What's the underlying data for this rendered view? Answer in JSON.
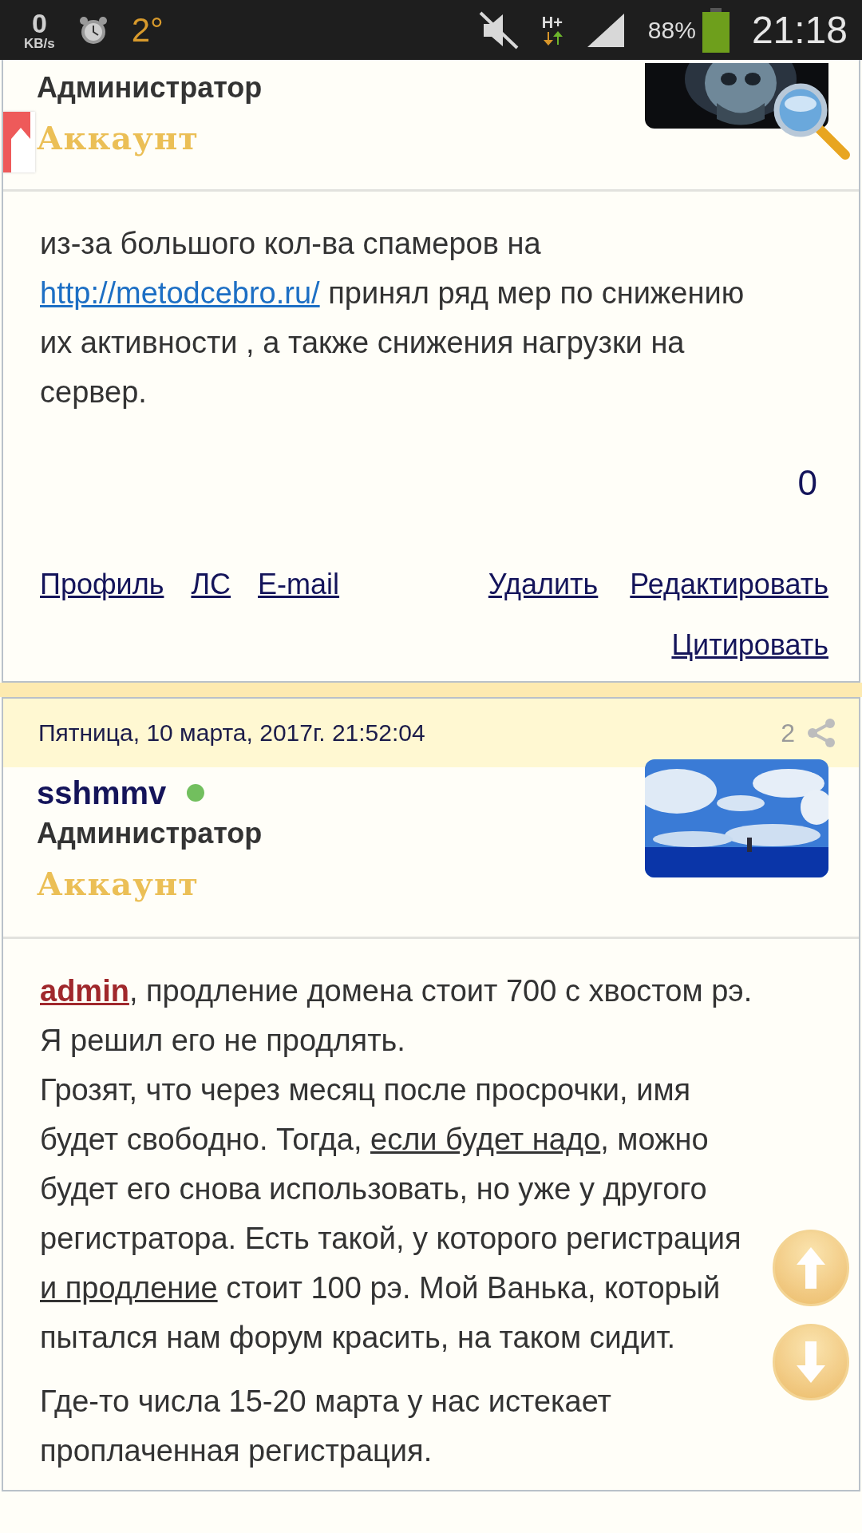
{
  "status_bar": {
    "speed_value": "0",
    "speed_unit": "KB/s",
    "temperature": "2°",
    "network_type": "H+",
    "battery_text": "88%",
    "time": "21:18"
  },
  "posts": [
    {
      "role": "Администратор",
      "rank": "Аккаунт",
      "body": [
        [
          [
            {
              "kind": "text",
              "text": "из-за большого кол-ва спамеров на "
            },
            {
              "kind": "link",
              "text": "http://metodcebro.ru/"
            },
            {
              "kind": "text",
              "text": " принял ряд мер по снижению их активности , а также снижения нагрузки на сервер."
            }
          ]
        ]
      ],
      "rating": "0",
      "actions": [
        {
          "kind": "user",
          "label": "Профиль"
        },
        {
          "kind": "user",
          "label": "ЛС"
        },
        {
          "kind": "user",
          "label": "E-mail"
        },
        {
          "kind": "post",
          "label": "Удалить"
        },
        {
          "kind": "post",
          "label": "Редактировать"
        },
        {
          "kind": "post",
          "label": "Цитировать"
        }
      ]
    },
    {
      "date": "Пятница, 10 марта, 2017г. 21:52:04",
      "number": "2",
      "username": "sshmmv",
      "online": true,
      "role": "Администратор",
      "rank": "Аккаунт",
      "body": [
        [
          [
            {
              "kind": "mention",
              "text": "admin"
            },
            {
              "kind": "text",
              "text": ", продление домена стоит 700 с хвостом рэ. Я решил его не продлять."
            }
          ],
          [
            {
              "kind": "text",
              "text": "Грозят, что через месяц после просрочки, имя будет свободно. Тогда, "
            },
            {
              "kind": "link",
              "text": "если будет надо"
            },
            {
              "kind": "text",
              "text": ", можно будет его снова использовать, но уже у другого регистратора. Есть такой, у которого регистрация "
            },
            {
              "kind": "link",
              "text": "и продление"
            },
            {
              "kind": "text",
              "text": " стоит 100 рэ. Мой Ванька, который пытался нам форум красить, на таком сидит."
            }
          ]
        ],
        [
          [
            {
              "kind": "text",
              "text": "Где-то числа 15-20 марта у нас истекает проплаченная регистрация."
            }
          ]
        ]
      ]
    }
  ]
}
